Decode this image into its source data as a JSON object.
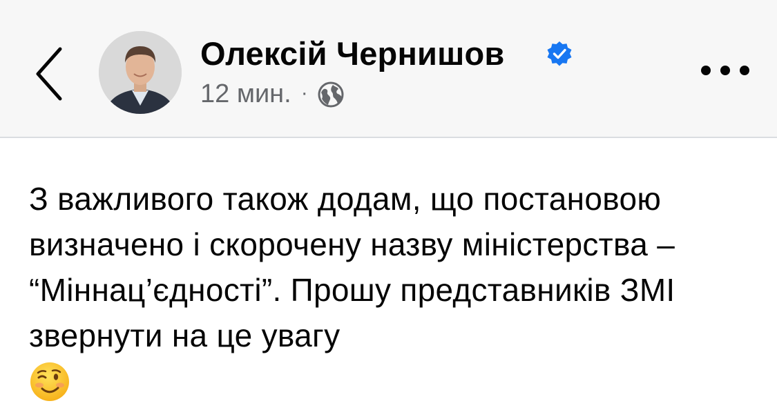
{
  "post": {
    "author_name": "Олексій Чернишов",
    "verified_icon": "verified-badge-icon",
    "time": "12 мин.",
    "separator": "·",
    "audience_icon": "globe-icon",
    "text": "З важливого також додам, що постановою визначено і скорочену назву міністерства – “Мінна­ц’єдності”. Прошу представників ЗМІ звернути на це увагу",
    "emoji_icon": "winking-face-emoji"
  },
  "toolbar": {
    "back_icon": "chevron-left-icon",
    "more_icon": "more-dots-icon"
  },
  "colors": {
    "header_bg": "#f7f7f7",
    "verified_blue": "#1877f2",
    "meta_gray": "#65676b",
    "text": "#050505"
  }
}
